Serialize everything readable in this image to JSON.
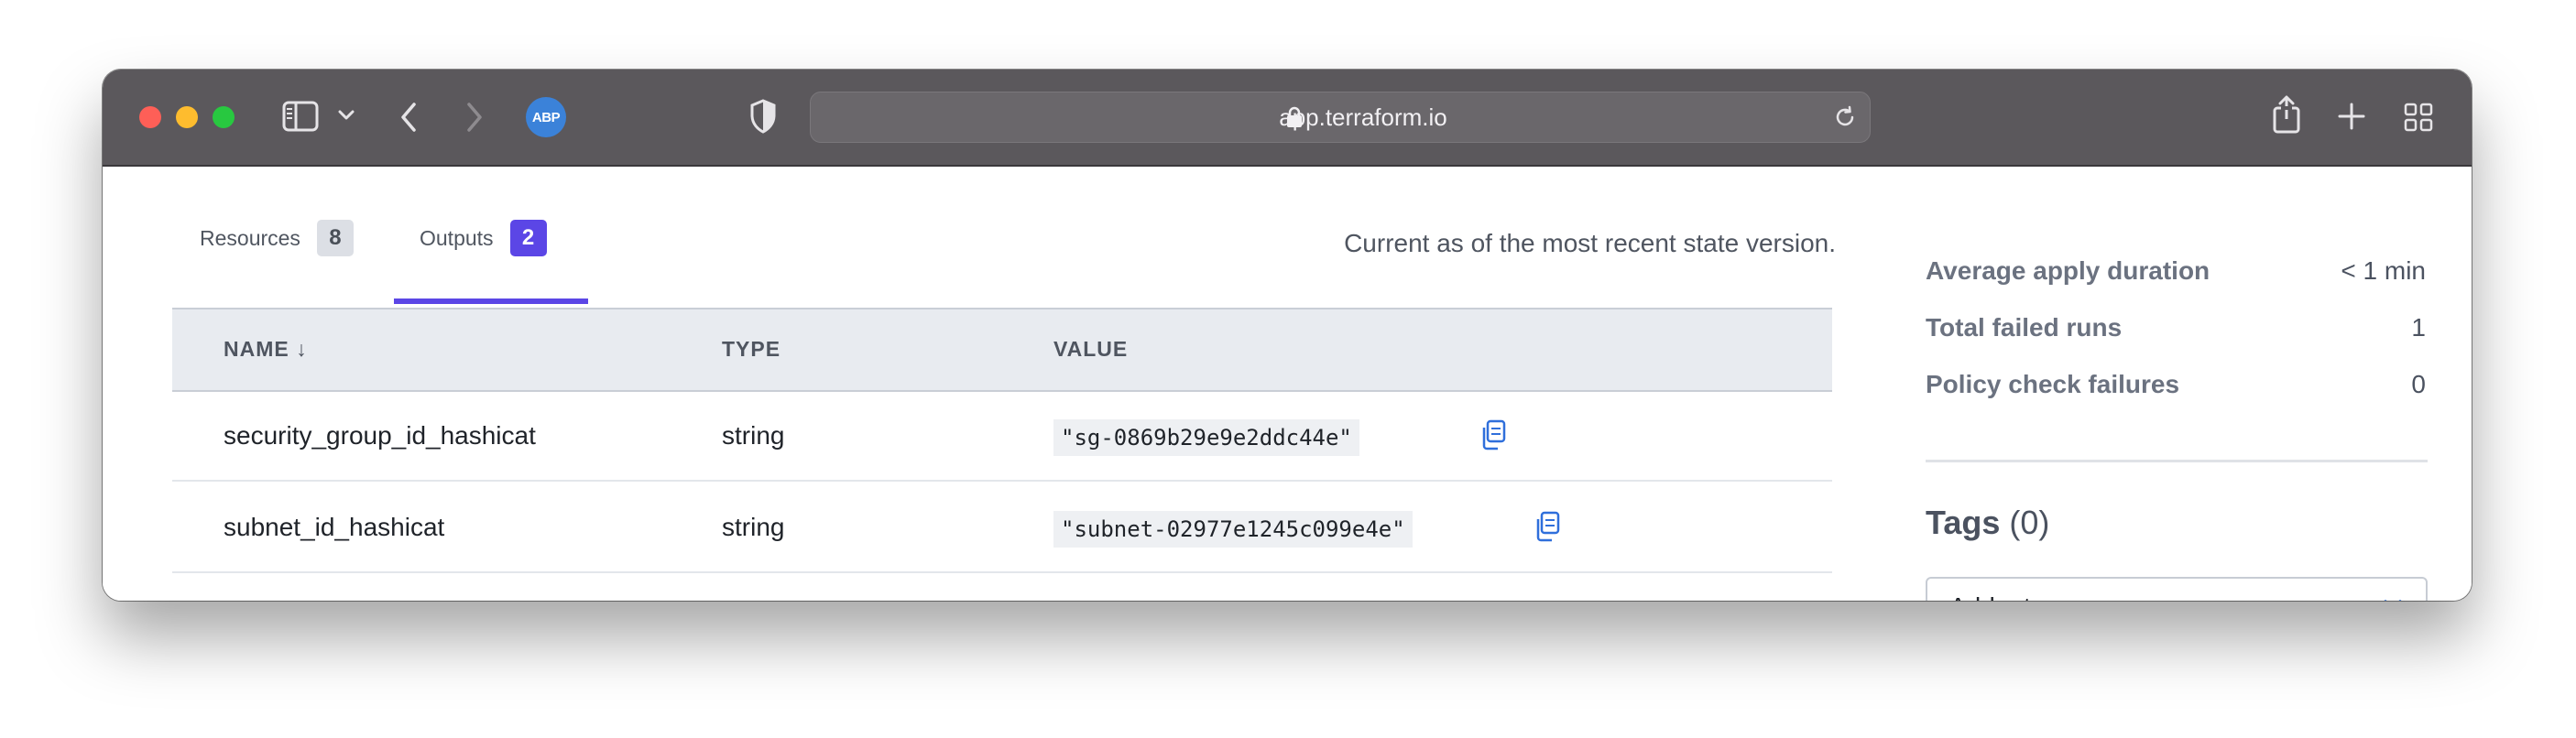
{
  "browser": {
    "url": "app.terraform.io",
    "extension_badge": "ABP"
  },
  "tabs": [
    {
      "label": "Resources",
      "count": "8"
    },
    {
      "label": "Outputs",
      "count": "2"
    }
  ],
  "status_text": "Current as of the most recent state version.",
  "table": {
    "columns": [
      "NAME ↓",
      "TYPE",
      "VALUE"
    ],
    "rows": [
      {
        "name": "security_group_id_hashicat",
        "type": "string",
        "value": "\"sg-0869b29e9e2ddc44e\""
      },
      {
        "name": "subnet_id_hashicat",
        "type": "string",
        "value": "\"subnet-02977e1245c099e4e\""
      }
    ]
  },
  "sidebar": {
    "metrics": [
      {
        "label": "Average apply duration",
        "value": "< 1 min"
      },
      {
        "label": "Total failed runs",
        "value": "1"
      },
      {
        "label": "Policy check failures",
        "value": "0"
      }
    ],
    "tags_title": "Tags",
    "tags_count": "(0)",
    "tag_select_placeholder": "Add a tag"
  },
  "colors": {
    "accent": "#5b46e6",
    "link_icon": "#2f6fdb",
    "titlebar": "#5b585c"
  }
}
